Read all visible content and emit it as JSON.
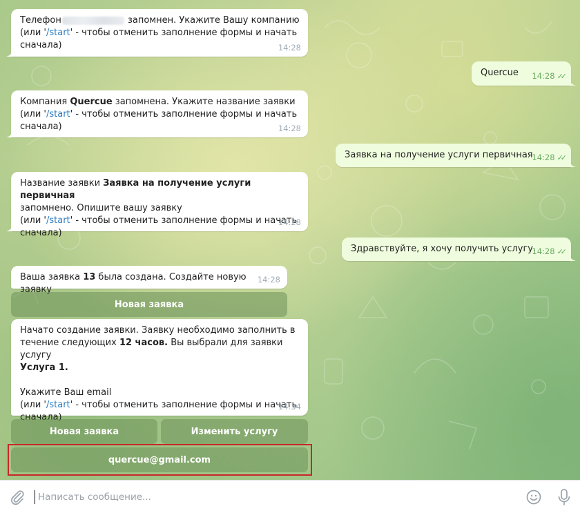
{
  "messages": {
    "m1": {
      "pre": "Телефон",
      "post": " запомнен. Укажите Вашу компанию",
      "l2_pre": "(или '",
      "cmd": "/start",
      "l2_post": "' - чтобы отменить заполнение формы и начать",
      "l3": "сначала)",
      "time": "14:28"
    },
    "m2": {
      "text": "Quercue",
      "time": "14:28"
    },
    "m3": {
      "pre": "Компания ",
      "bold": "Quercue",
      "post": " запомнена. Укажите название заявки",
      "l2_pre": "(или '",
      "cmd": "/start",
      "l2_post": "' - чтобы отменить заполнение формы и начать",
      "l3": "сначала)",
      "time": "14:28"
    },
    "m4": {
      "text": "Заявка на получение услуги первичная",
      "time": "14:28"
    },
    "m5": {
      "pre": "Название заявки ",
      "bold": "Заявка на получение услуги первичная",
      "l2": "запомнено. Опишите вашу заявку",
      "l3_pre": "(или '",
      "cmd": "/start",
      "l3_post": "' - чтобы отменить заполнение формы и начать",
      "l4": "сначала)",
      "time": "14:28"
    },
    "m6": {
      "text": "Здравствуйте, я хочу получить услугу.",
      "time": "14:28"
    },
    "m7": {
      "pre": "Ваша заявка ",
      "bold": "13",
      "post": " была создана. Создайте новую заявку",
      "time": "14:28"
    },
    "m8": {
      "l1": "Начато создание заявки. Заявку необходимо заполнить в",
      "l2_pre": "течение следующих ",
      "l2_bold": "12 часов.",
      "l2_post": " Вы выбрали для заявки услугу",
      "l3_bold": "Услуга 1.",
      "l4": "Укажите Ваш email",
      "l5_pre": "(или '",
      "cmd": "/start",
      "l5_post": "' - чтобы отменить заполнение формы и начать",
      "l6": "сначала)",
      "time": "14:34"
    }
  },
  "keyboards": {
    "new_request_1": "Новая заявка",
    "new_request_2": "Новая заявка",
    "change_service": "Изменить услугу",
    "email": "quercue@gmail.com"
  },
  "composer": {
    "placeholder": "Написать сообщение..."
  },
  "colors": {
    "accent_link": "#2a7bc0",
    "highlight": "#c62828",
    "read_checks": "#5eb05f"
  }
}
